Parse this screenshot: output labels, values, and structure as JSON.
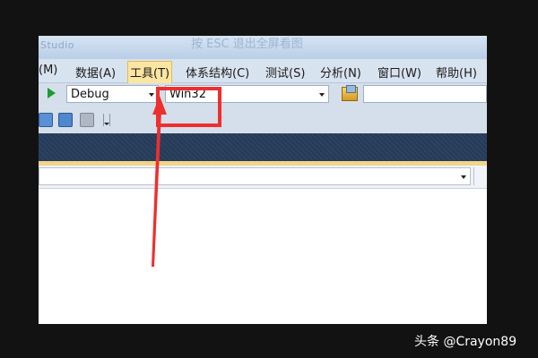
{
  "window": {
    "app_name": "Studio",
    "fullscreen_hint": "按 ESC 退出全屏看图"
  },
  "menu": {
    "items": [
      {
        "label": "(M)"
      },
      {
        "label": "数据(A)"
      },
      {
        "label": "工具(T)",
        "active": true
      },
      {
        "label": "体系结构(C)"
      },
      {
        "label": "测试(S)"
      },
      {
        "label": "分析(N)"
      },
      {
        "label": "窗口(W)"
      },
      {
        "label": "帮助(H)"
      }
    ]
  },
  "toolbar": {
    "config_value": "Debug",
    "platform_value": "Win32",
    "find_value": ""
  },
  "strip": {
    "value": ""
  },
  "annotation": {
    "highlight_color": "#ee2f2f",
    "target": "工具(T)"
  },
  "watermark": "头条 @Crayon89"
}
